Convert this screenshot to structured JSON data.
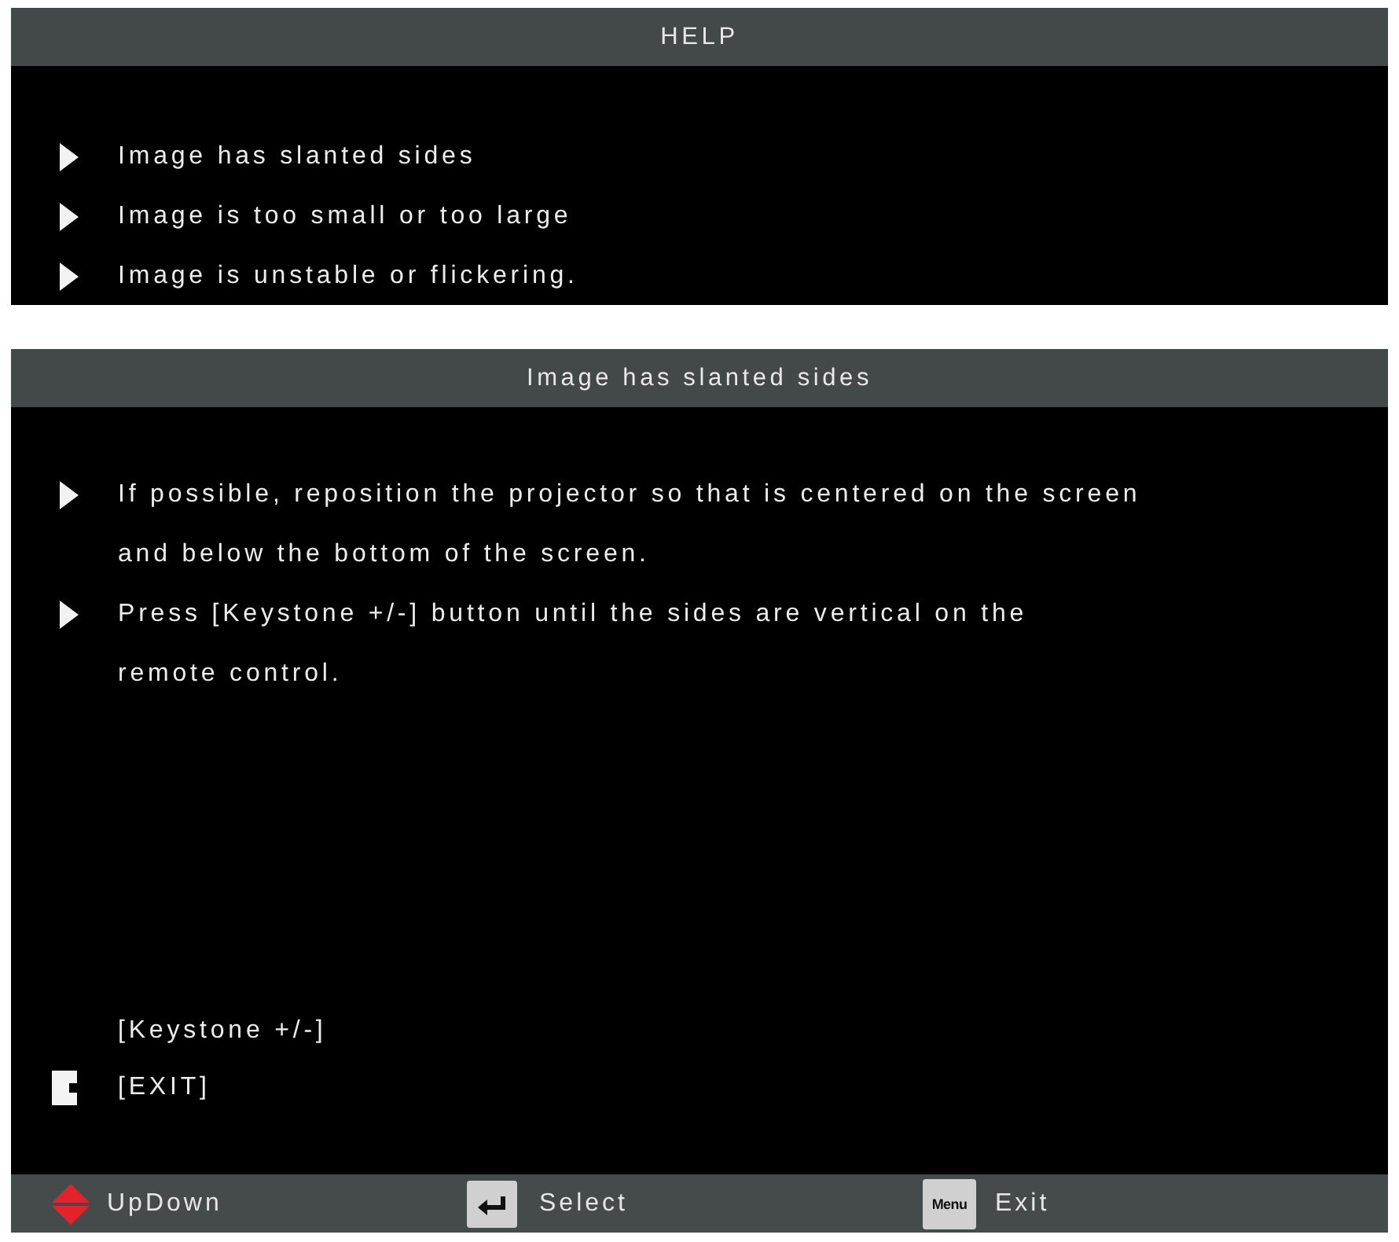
{
  "help_panel": {
    "title": "HELP",
    "items": [
      "Image has slanted sides",
      "Image is too small or too large",
      "Image is unstable or flickering."
    ]
  },
  "topic_panel": {
    "title": "Image has slanted sides",
    "tips": [
      "If possible, reposition the projector so that is centered on the screen\nand below the bottom of the screen.",
      "Press [Keystone +/-] button until the sides are vertical on the\nremote control."
    ],
    "options": [
      {
        "label": "[Keystone +/-]",
        "selected": false
      },
      {
        "label": "[EXIT]",
        "selected": true
      }
    ]
  },
  "footer": [
    {
      "kind": "updown",
      "label": "UpDown"
    },
    {
      "kind": "enter",
      "label": "Select"
    },
    {
      "kind": "menu",
      "key": "Menu",
      "label": "Exit"
    }
  ]
}
